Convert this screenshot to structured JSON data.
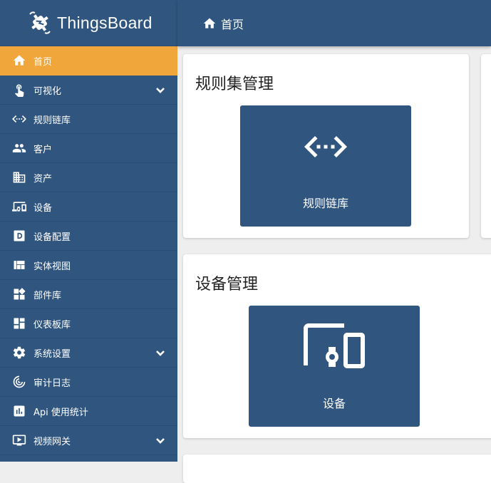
{
  "brand": {
    "name": "ThingsBoard"
  },
  "topbar": {
    "title": "首页"
  },
  "sidebar": {
    "items": [
      {
        "label": "首页",
        "icon": "home-icon",
        "active": true,
        "expandable": false
      },
      {
        "label": "可视化",
        "icon": "touch-icon",
        "active": false,
        "expandable": true
      },
      {
        "label": "规则链库",
        "icon": "rule-chain-icon",
        "active": false,
        "expandable": false
      },
      {
        "label": "客户",
        "icon": "customers-icon",
        "active": false,
        "expandable": false
      },
      {
        "label": "资产",
        "icon": "assets-icon",
        "active": false,
        "expandable": false
      },
      {
        "label": "设备",
        "icon": "devices-icon",
        "active": false,
        "expandable": false
      },
      {
        "label": "设备配置",
        "icon": "device-profile-icon",
        "active": false,
        "expandable": false
      },
      {
        "label": "实体视图",
        "icon": "entity-view-icon",
        "active": false,
        "expandable": false
      },
      {
        "label": "部件库",
        "icon": "widgets-icon",
        "active": false,
        "expandable": false
      },
      {
        "label": "仪表板库",
        "icon": "dashboard-icon",
        "active": false,
        "expandable": false
      },
      {
        "label": "系统设置",
        "icon": "gear-icon",
        "active": false,
        "expandable": true
      },
      {
        "label": "审计日志",
        "icon": "audit-log-icon",
        "active": false,
        "expandable": false
      },
      {
        "label": "Api 使用统计",
        "icon": "api-usage-icon",
        "active": false,
        "expandable": false
      },
      {
        "label": "视频网关",
        "icon": "video-icon",
        "active": false,
        "expandable": true
      }
    ]
  },
  "cards": [
    {
      "title": "规则集管理",
      "tile_label": "规则链库",
      "tile_icon": "rule-chain-icon"
    },
    {
      "title": "设备管理",
      "tile_label": "设备",
      "tile_icon": "devices-icon"
    }
  ],
  "colors": {
    "primary": "#305680",
    "accent": "#f0a63b",
    "background": "#eeeeee"
  }
}
